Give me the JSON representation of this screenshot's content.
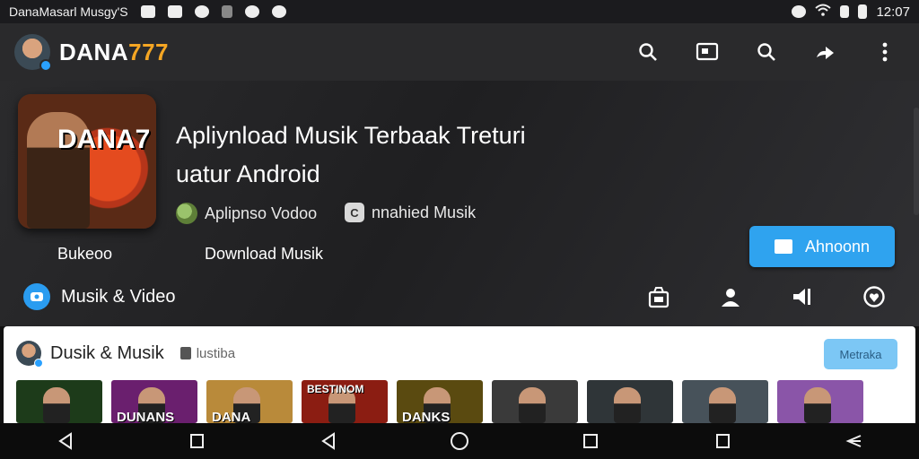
{
  "status_bar": {
    "app_text": "DanaMasarl Musgy'S",
    "time": "12:07"
  },
  "app_bar": {
    "brand_prefix": "DANA",
    "brand_accent": "777",
    "accent_color": "#f5a623"
  },
  "hero": {
    "cover_title": "DANA7",
    "title_line1": "Apliynload Musik Terbaak Treturi",
    "title_line2": "uatur Android",
    "meta_left": "Aplipnso Vodoo",
    "meta_right_badge": "C",
    "meta_right": "nnahied Musik",
    "label_left": "Bukeoo",
    "label_center": "Download Musik",
    "primary_button": "Ahnoonn",
    "primary_color": "#2fa3ef",
    "category": "Musik & Video"
  },
  "card": {
    "title": "Dusik & Musik",
    "tag": "lustiba",
    "pill": "Metraka",
    "thumbnails": [
      {
        "text": "",
        "bg": "#1d3b1a"
      },
      {
        "text": "DUNANS",
        "bg": "#6a1f6e"
      },
      {
        "text": "DANA",
        "bg": "#b98a3a"
      },
      {
        "text": "BESTINOM",
        "bg": "#8b1d12"
      },
      {
        "text": "DANKS",
        "bg": "#5a4a10"
      },
      {
        "text": "",
        "bg": "#3a3a3a"
      },
      {
        "text": "",
        "bg": "#2f3538"
      },
      {
        "text": "",
        "bg": "#47525a"
      },
      {
        "text": "",
        "bg": "#8a55a8"
      }
    ]
  }
}
